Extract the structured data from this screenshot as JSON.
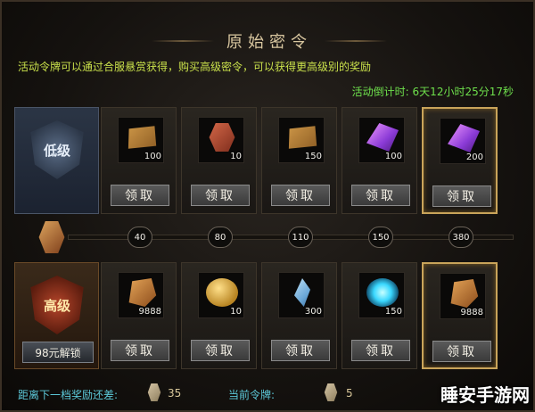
{
  "title": "原始密令",
  "info": "活动令牌可以通过合服悬赏获得，购买高级密令，可以获得更高级别的奖励",
  "countdown": {
    "label": "活动倒计时:",
    "value": "6天12小时25分17秒"
  },
  "tiers": {
    "basic": {
      "emblem_text": "低级"
    },
    "advanced": {
      "emblem_text": "高级",
      "unlock_label": "98元解锁"
    }
  },
  "claim_label": "领取",
  "basic_rewards": [
    {
      "icon": "scroll-icon",
      "count": "100"
    },
    {
      "icon": "token-icon",
      "count": "10"
    },
    {
      "icon": "scroll-icon",
      "count": "150"
    },
    {
      "icon": "crystal-icon",
      "count": "100"
    },
    {
      "icon": "crystal-icon",
      "count": "200"
    }
  ],
  "advanced_rewards": [
    {
      "icon": "rune-icon",
      "count": "9888"
    },
    {
      "icon": "coin-icon",
      "count": "10"
    },
    {
      "icon": "blue-crystal-icon",
      "count": "300"
    },
    {
      "icon": "orb-icon",
      "count": "150"
    },
    {
      "icon": "rune-icon",
      "count": "9888"
    }
  ],
  "milestones": [
    "40",
    "80",
    "110",
    "150",
    "380"
  ],
  "progress_fraction": 0,
  "footer": {
    "next_label": "距离下一档奖励还差:",
    "next_value": "35",
    "current_label": "当前令牌:",
    "current_value": "5"
  },
  "watermark": "睡安手游网",
  "colors": {
    "info": "#c9e04b",
    "countdown": "#6ee04c",
    "footer_label": "#5cc8d8",
    "highlight_border": "#c9a45a"
  }
}
